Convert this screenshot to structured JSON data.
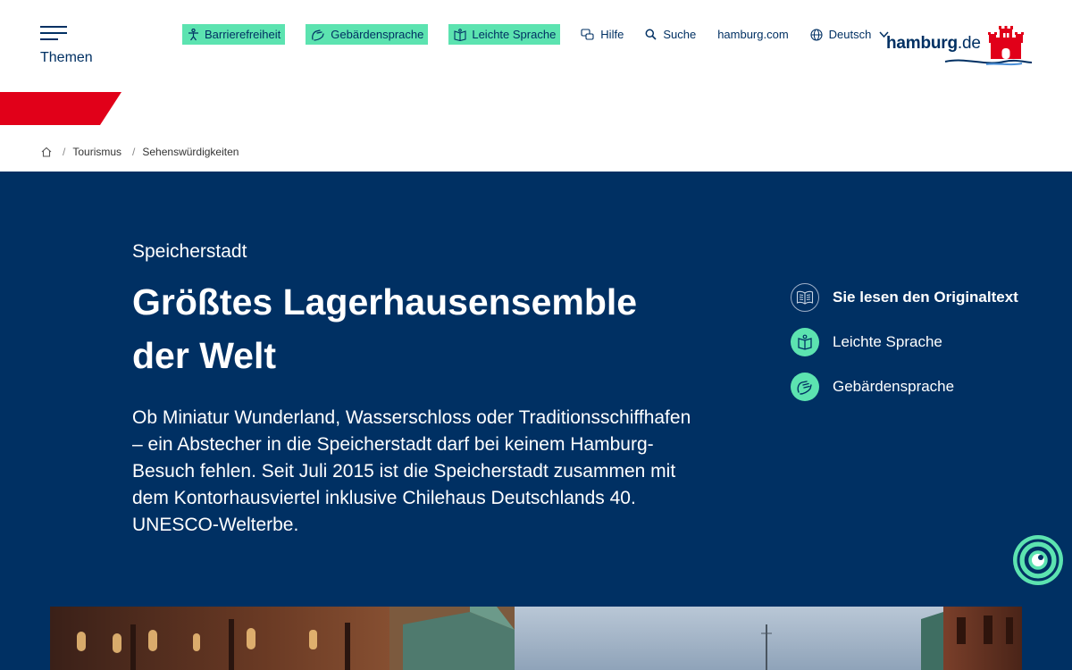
{
  "header": {
    "menu_label": "Themen",
    "pills": [
      {
        "label": "Barrierefreiheit",
        "icon": "accessibility-icon"
      },
      {
        "label": "Gebärdensprache",
        "icon": "sign-language-icon"
      },
      {
        "label": "Leichte Sprache",
        "icon": "easy-language-icon"
      }
    ],
    "links": {
      "help": "Hilfe",
      "search": "Suche",
      "external": "hamburg.com",
      "language": "Deutsch"
    },
    "logo_prefix": "hamburg",
    "logo_suffix": ".de"
  },
  "breadcrumb": {
    "items": [
      "Tourismus",
      "Sehenswürdigkeiten"
    ]
  },
  "hero": {
    "kicker": "Speicherstadt",
    "title": "Größtes Lagerhausensemble der Welt",
    "lead": "Ob Miniatur Wunderland, Wasserschloss oder Traditionsschiffhafen – ein Abstecher in die Speicherstadt darf bei keinem Hamburg-Besuch fehlen. Seit Juli 2015 ist die Speicherstadt zusammen mit dem Kontorhausviertel inklusive Chilehaus Deutschlands 40. UNESCO-Welterbe.",
    "language_options": [
      {
        "label": "Sie lesen den Originaltext",
        "active": true,
        "icon": "book-icon"
      },
      {
        "label": "Leichte Sprache",
        "active": false,
        "icon": "easy-language-icon"
      },
      {
        "label": "Gebärdensprache",
        "active": false,
        "icon": "sign-language-icon"
      }
    ]
  },
  "colors": {
    "navy": "#003063",
    "mint": "#5ce3b0",
    "red": "#e10019"
  }
}
